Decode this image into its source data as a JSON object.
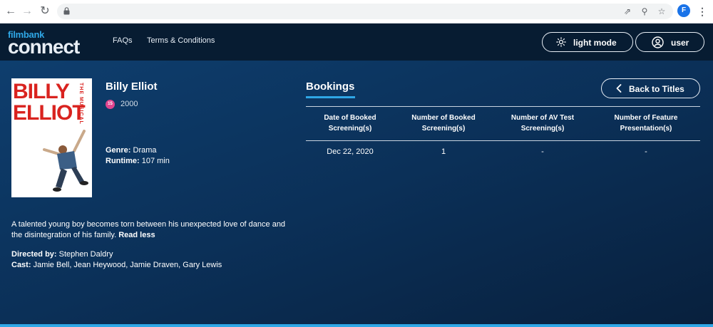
{
  "app": {
    "logo_top": "filmbank",
    "logo_bottom": "connect",
    "nav": [
      "FAQs",
      "Terms & Conditions"
    ],
    "light_mode_label": "light mode",
    "user_label": "user"
  },
  "browser": {
    "avatar_letter": "F"
  },
  "film": {
    "poster_line1": "BILLY",
    "poster_line2": "ELLIOT",
    "poster_line3": "THE MUSICAL",
    "title": "Billy Elliot",
    "rating": "15",
    "year": "2000",
    "genre_label": "Genre:",
    "genre": "Drama",
    "runtime_label": "Runtime:",
    "runtime": "107 min",
    "description": "A talented young boy becomes torn between his unexpected love of dance and the disintegration of his family.",
    "read_less": "Read less",
    "directed_label": "Directed by:",
    "director": "Stephen Daldry",
    "cast_label": "Cast:",
    "cast": "Jamie Bell, Jean Heywood, Jamie Draven, Gary Lewis"
  },
  "bookings": {
    "title": "Bookings",
    "back_label": "Back to Titles",
    "headers": [
      [
        "Date of Booked",
        "Screening(s)"
      ],
      [
        "Number of Booked",
        "Screening(s)"
      ],
      [
        "Number of AV Test",
        "Screening(s)"
      ],
      [
        "Number of Feature",
        "Presentation(s)"
      ]
    ],
    "rows": [
      [
        "Dec 22, 2020",
        "1",
        "-",
        "-"
      ]
    ]
  },
  "colors": {
    "accent": "#2fa7e6",
    "header_bg": "#071c32",
    "main_bg": "#0b3058",
    "rating_badge": "#e0458f",
    "poster_red": "#d9231f"
  },
  "icons": [
    "back-arrow-icon",
    "forward-arrow-icon",
    "reload-icon",
    "lock-icon",
    "open-external-icon",
    "zoom-icon",
    "star-icon",
    "more-vert-icon",
    "sun-icon",
    "user-circle-icon",
    "chevron-left-icon"
  ]
}
